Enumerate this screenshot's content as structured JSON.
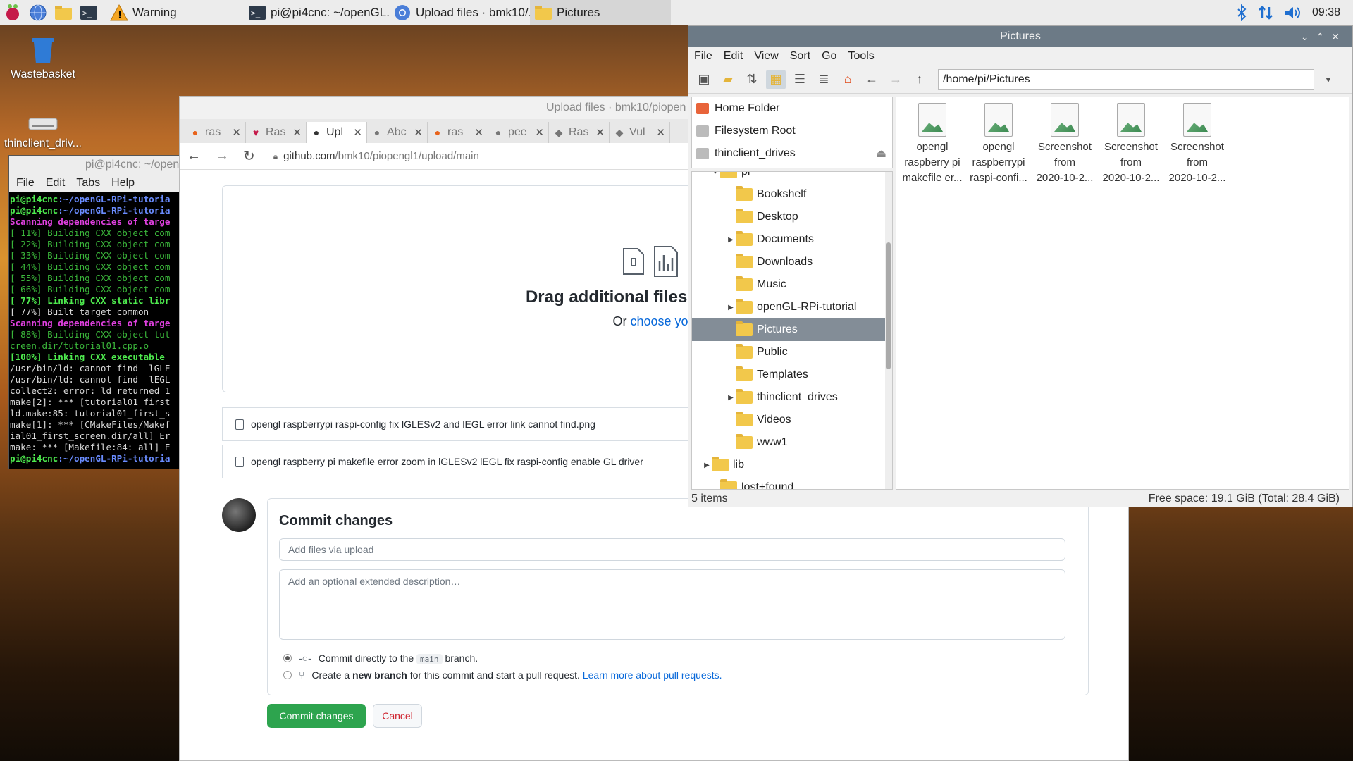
{
  "taskbar": {
    "tasks": [
      "Warning",
      "pi@pi4cnc: ~/openGL...",
      "Upload files · bmk10/...",
      "Pictures"
    ],
    "clock": "09:38"
  },
  "desktop": {
    "icons": [
      "Wastebasket",
      "thinclient_driv..."
    ]
  },
  "terminal": {
    "title": "pi@pi4cnc: ~/open",
    "menu": [
      "File",
      "Edit",
      "Tabs",
      "Help"
    ],
    "lines": [
      {
        "c": "prompt",
        "t": "pi@pi4cnc",
        "p": ":~/openGL-RPi-tutoria"
      },
      {
        "c": "prompt",
        "t": "pi@pi4cnc",
        "p": ":~/openGL-RPi-tutoria"
      },
      {
        "c": "mag",
        "t": "Scanning dependencies of targe"
      },
      {
        "c": "green",
        "t": "[ 11%] Building CXX object com"
      },
      {
        "c": "green",
        "t": "[ 22%] Building CXX object com"
      },
      {
        "c": "green",
        "t": "[ 33%] Building CXX object com"
      },
      {
        "c": "green",
        "t": "[ 44%] Building CXX object com"
      },
      {
        "c": "green",
        "t": "[ 55%] Building CXX object com"
      },
      {
        "c": "green",
        "t": "[ 66%] Building CXX object com"
      },
      {
        "c": "greenb",
        "t": "[ 77%] Linking CXX static libr"
      },
      {
        "c": "white",
        "t": "[ 77%] Built target common"
      },
      {
        "c": "mag",
        "t": "Scanning dependencies of targe"
      },
      {
        "c": "green",
        "t": "[ 88%] Building CXX object tut"
      },
      {
        "c": "green",
        "t": "creen.dir/tutorial01.cpp.o"
      },
      {
        "c": "greenb",
        "t": "[100%] Linking CXX executable"
      },
      {
        "c": "white",
        "t": "/usr/bin/ld: cannot find -lGLE"
      },
      {
        "c": "white",
        "t": "/usr/bin/ld: cannot find -lEGL"
      },
      {
        "c": "white",
        "t": "collect2: error: ld returned 1"
      },
      {
        "c": "white",
        "t": "make[2]: *** [tutorial01_first"
      },
      {
        "c": "white",
        "t": "ld.make:85: tutorial01_first_s"
      },
      {
        "c": "white",
        "t": "make[1]: *** [CMakeFiles/Makef"
      },
      {
        "c": "white",
        "t": "ial01_first_screen.dir/all] Er"
      },
      {
        "c": "white",
        "t": "make: *** [Makefile:84: all] E"
      },
      {
        "c": "prompt",
        "t": "pi@pi4cnc",
        "p": ":~/openGL-RPi-tutoria"
      }
    ]
  },
  "browser": {
    "title": "Upload files · bmk10/piopen",
    "tabs": [
      "ras",
      "Ras",
      "Upl",
      "Abc",
      "ras",
      "pee",
      "Ras",
      "Vul"
    ],
    "address_host": "github.com",
    "address_path": "/bmk10/piopengl1/upload/main",
    "drop_title": "Drag additional files here to add t",
    "drop_sub_prefix": "Or ",
    "drop_sub_link": "choose your f",
    "files": [
      "opengl raspberrypi raspi-config fix lGLESv2 and lEGL error link cannot find.png",
      "opengl raspberry pi makefile error zoom in lGLESv2 lEGL fix raspi-config enable GL driver"
    ],
    "commit": {
      "heading": "Commit changes",
      "summary_placeholder": "Add files via upload",
      "description_placeholder": "Add an optional extended description…",
      "option1_prefix": "Commit directly to the",
      "option1_branch": "main",
      "option1_suffix": "branch.",
      "option2_prefix": "Create a",
      "option2_bold": "new branch",
      "option2_middle": "for this commit and start a pull request.",
      "option2_link": "Learn more about pull requests.",
      "submit": "Commit changes",
      "cancel": "Cancel"
    }
  },
  "file_manager": {
    "title": "Pictures",
    "menu": [
      "File",
      "Edit",
      "View",
      "Sort",
      "Go",
      "Tools"
    ],
    "path": "/home/pi/Pictures",
    "places": [
      "Home Folder",
      "Filesystem Root",
      "thinclient_drives"
    ],
    "tree": [
      {
        "label": "pi",
        "expand": "open"
      },
      {
        "label": "Bookshelf",
        "expand": ""
      },
      {
        "label": "Desktop",
        "expand": ""
      },
      {
        "label": "Documents",
        "expand": "closed"
      },
      {
        "label": "Downloads",
        "expand": ""
      },
      {
        "label": "Music",
        "expand": ""
      },
      {
        "label": "openGL-RPi-tutorial",
        "expand": "closed"
      },
      {
        "label": "Pictures",
        "expand": "",
        "selected": true
      },
      {
        "label": "Public",
        "expand": ""
      },
      {
        "label": "Templates",
        "expand": ""
      },
      {
        "label": "thinclient_drives",
        "expand": "closed"
      },
      {
        "label": "Videos",
        "expand": ""
      },
      {
        "label": "www1",
        "expand": ""
      },
      {
        "label": "lib",
        "expand": "closed"
      },
      {
        "label": "lost+found",
        "expand": ""
      }
    ],
    "files": [
      [
        "opengl",
        "raspberry pi",
        "makefile er..."
      ],
      [
        "opengl",
        "raspberrypi",
        "raspi-confi..."
      ],
      [
        "Screenshot",
        "from",
        "2020-10-2..."
      ],
      [
        "Screenshot",
        "from",
        "2020-10-2..."
      ],
      [
        "Screenshot",
        "from",
        "2020-10-2..."
      ]
    ],
    "status_items": "5 items",
    "status_free": "Free space: 19.1 GiB (Total: 28.4 GiB)"
  }
}
